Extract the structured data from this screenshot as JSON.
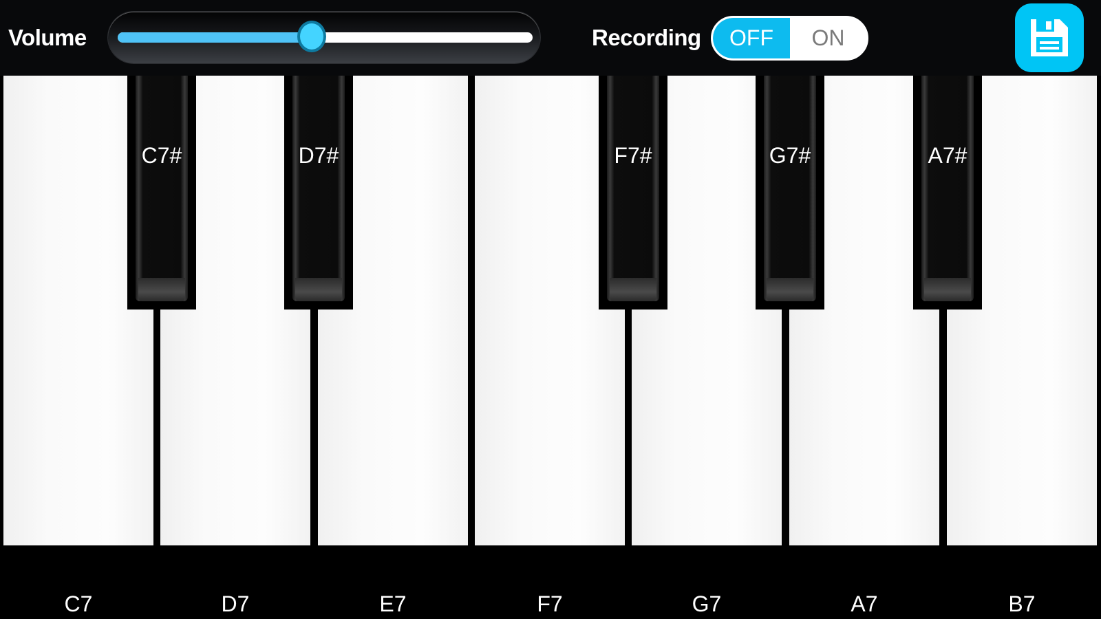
{
  "header": {
    "volume_label": "Volume",
    "volume_value": 0.47,
    "recording_label": "Recording",
    "recording_toggle": {
      "off_label": "OFF",
      "on_label": "ON",
      "state": "OFF"
    },
    "save_icon": "floppy-disk-icon"
  },
  "colors": {
    "accent": "#0dbbef",
    "slider_fill": "#4fc3f7",
    "save_button": "#00c5f5"
  },
  "piano": {
    "white_keys": [
      {
        "label": "C7"
      },
      {
        "label": "D7"
      },
      {
        "label": "E7"
      },
      {
        "label": "F7"
      },
      {
        "label": "G7"
      },
      {
        "label": "A7"
      },
      {
        "label": "B7"
      }
    ],
    "black_keys": [
      {
        "label": "C7#"
      },
      {
        "label": "D7#"
      },
      {
        "label": "F7#"
      },
      {
        "label": "G7#"
      },
      {
        "label": "A7#"
      }
    ]
  }
}
